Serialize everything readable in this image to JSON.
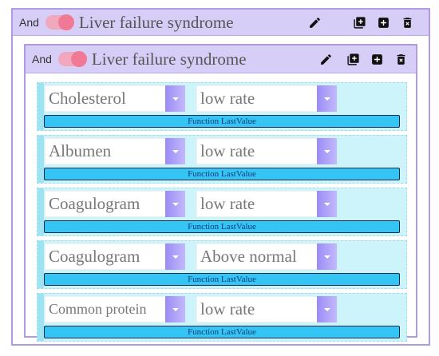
{
  "outer": {
    "operator": "And",
    "title": "Liver failure syndrome"
  },
  "inner": {
    "operator": "And",
    "title": "Liver failure syndrome"
  },
  "rows": [
    {
      "parameter": "Cholesterol",
      "condition": "low rate",
      "function": "Function LastValue"
    },
    {
      "parameter": "Albumen",
      "condition": "low rate",
      "function": "Function LastValue"
    },
    {
      "parameter": "Coagulogram",
      "condition": "low rate",
      "function": "Function LastValue"
    },
    {
      "parameter": "Coagulogram",
      "condition": "Above normal",
      "function": "Function LastValue"
    },
    {
      "parameter": "Common protein",
      "condition": "low rate",
      "function": "Function LastValue"
    }
  ],
  "colors": {
    "header": "#d6cef6",
    "border": "#b09be3",
    "toggle": "#f07a95",
    "row": "#cdf3fb",
    "function_bar": "#35c5f5",
    "select_arrow": "#9b8cf5"
  },
  "icons": [
    "pencil-icon",
    "add-group-icon",
    "add-icon",
    "delete-icon"
  ]
}
